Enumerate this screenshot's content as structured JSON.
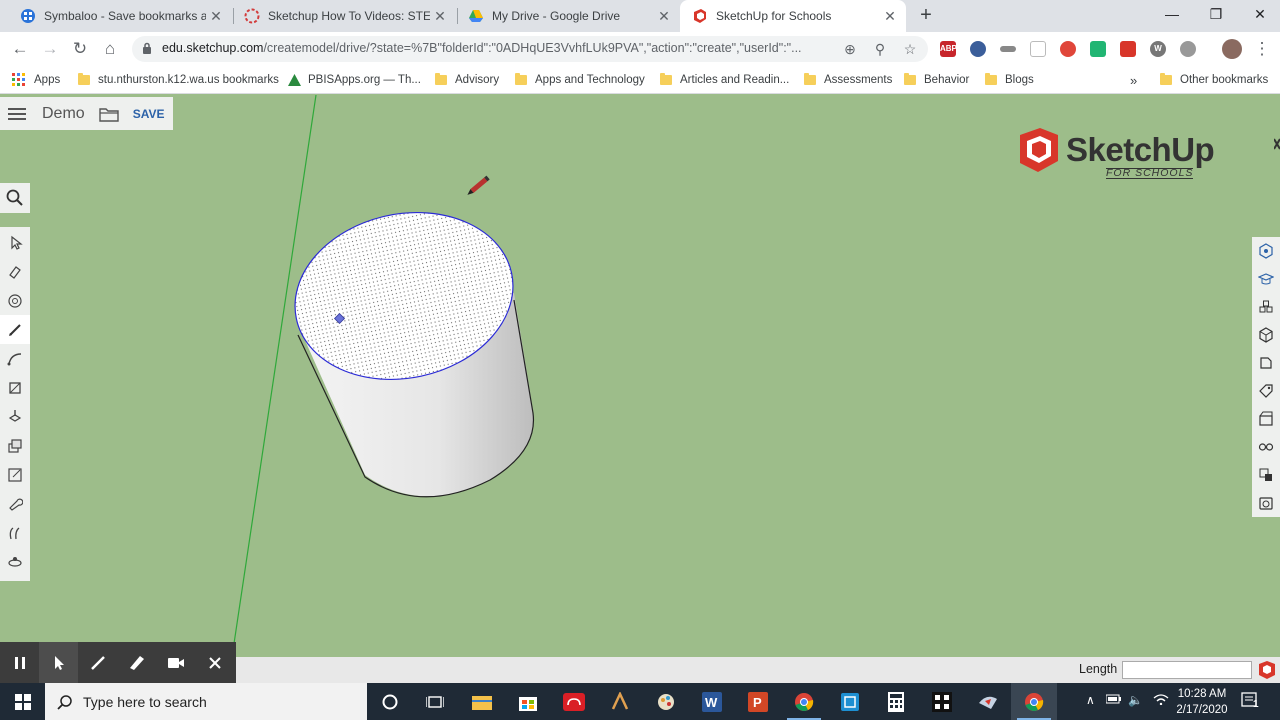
{
  "browser": {
    "tabs": [
      {
        "title": "Symbaloo - Save bookmarks and",
        "favicon": "symbaloo-icon",
        "active": false
      },
      {
        "title": "Sketchup How To Videos: STEM &",
        "favicon": "stem-icon",
        "active": false
      },
      {
        "title": "My Drive - Google Drive",
        "favicon": "google-drive-icon",
        "active": false
      },
      {
        "title": "SketchUp for Schools",
        "favicon": "sketchup-icon",
        "active": true
      }
    ],
    "url_host": "edu.sketchup.com",
    "url_path": "/createmodel/drive/?state=%7B\"folderId\":\"0ADHqUE3VvhfLUk9PVA\",\"action\":\"create\",\"userId\":\"...",
    "extensions": [
      {
        "label": "ABP",
        "color": "#c7252b"
      },
      {
        "label": "",
        "color": "#3b5e9a"
      },
      {
        "label": "",
        "color": "#888888"
      },
      {
        "label": "",
        "color": "#bbbbbb"
      },
      {
        "label": "",
        "color": "#e0463a"
      },
      {
        "label": "",
        "color": "#21b573"
      },
      {
        "label": "",
        "color": "#d8362a"
      },
      {
        "label": "W",
        "color": "#777777"
      },
      {
        "label": "",
        "color": "#999999"
      }
    ]
  },
  "bookmarks": {
    "apps": "Apps",
    "items": [
      "stu.nthurston.k12.wa.us bookmarks",
      "PBISApps.org — Th...",
      "Advisory",
      "Apps and Technology",
      "Articles and Readin...",
      "Assessments",
      "Behavior",
      "Blogs"
    ],
    "more": "»",
    "other": "Other bookmarks"
  },
  "app": {
    "doc_name": "Demo",
    "save_label": "SAVE",
    "logo_text": "SketchUp",
    "logo_sub": "FOR SCHOOLS",
    "left_tools": [
      "select-tool",
      "eraser-tool",
      "paint-bucket-tool",
      "pencil-tool",
      "arc-tool",
      "rectangle-tool",
      "push-pull-tool",
      "move-tool",
      "scale-tool",
      "tape-measure-tool",
      "orbit-tool",
      "walk-tool"
    ],
    "active_tool": "pencil-tool",
    "right_panel": [
      "entity-info-icon",
      "instructor-icon",
      "components-icon",
      "materials-icon",
      "styles-icon",
      "tags-icon",
      "scenes-icon",
      "display-icon",
      "outliner-icon",
      "solid-inspector-icon"
    ],
    "measurement_label": "Length",
    "measurement_value": ""
  },
  "recorder": {
    "buttons": [
      "pause-icon",
      "cursor-icon",
      "pen-icon",
      "highlighter-icon",
      "camera-icon",
      "close-icon"
    ]
  },
  "taskbar": {
    "search_placeholder": "Type here to search",
    "time": "10:28 AM",
    "date": "2/17/2020",
    "notification_count": "1"
  }
}
